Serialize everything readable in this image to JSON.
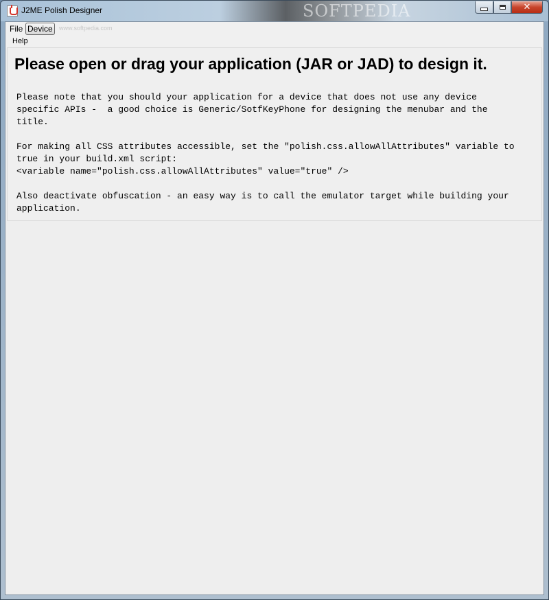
{
  "window": {
    "title": "J2ME Polish Designer",
    "watermark": "SOFTPEDIA",
    "controls": {
      "minimize": "minimize",
      "maximize": "maximize",
      "close": "✕"
    }
  },
  "menubar": {
    "items": [
      {
        "label": "File"
      },
      {
        "label": "Device"
      },
      {
        "label": "Help"
      }
    ],
    "watermark_small": "www.softpedia.com"
  },
  "content": {
    "heading": "Please open or drag your application (JAR or JAD) to design it.",
    "paragraphs": [
      "Please note that you should your application for a device that does not use any device\nspecific APIs -  a good choice is Generic/SotfKeyPhone for designing the menubar and the\ntitle.",
      "For making all CSS attributes accessible, set the \"polish.css.allowAllAttributes\" variable to\ntrue in your build.xml script:\n<variable name=\"polish.css.allowAllAttributes\" value=\"true\" />",
      "Also deactivate obfuscation - an easy way is to call the emulator target while building your\napplication."
    ]
  },
  "colors": {
    "client_bg": "#eeeeee",
    "close_button": "#c8452c"
  }
}
